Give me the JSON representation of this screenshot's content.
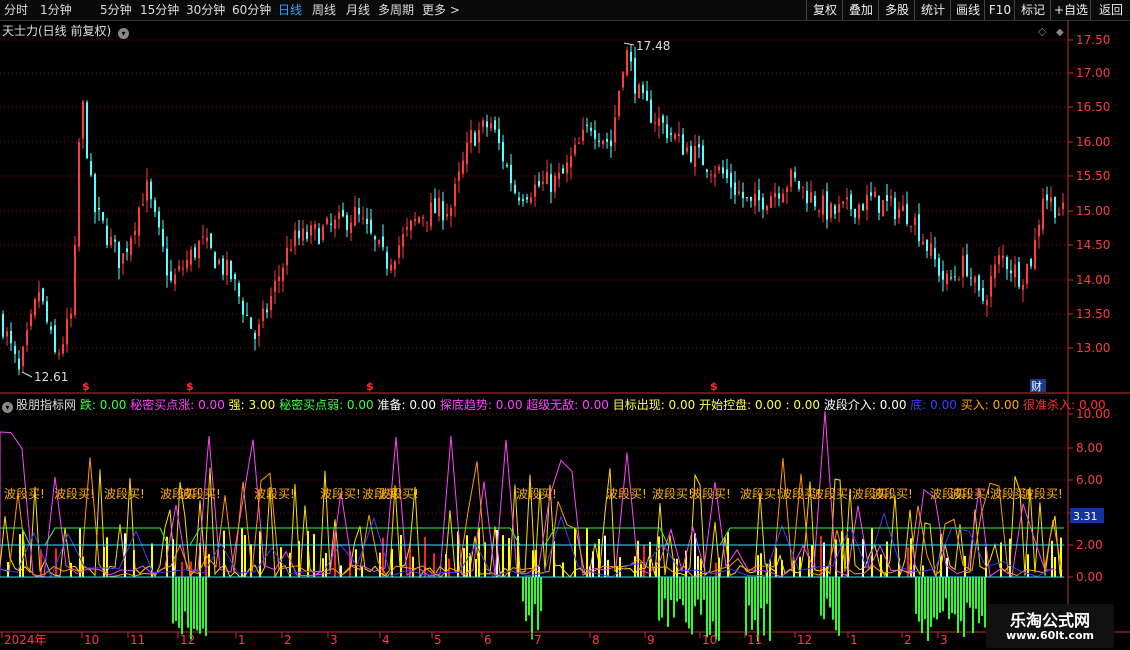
{
  "toolbar": {
    "periods": [
      "分时",
      "1分钟",
      "5分钟",
      "15分钟",
      "30分钟",
      "60分钟",
      "日线",
      "周线",
      "月线",
      "多周期",
      "更多 >"
    ],
    "active_period": "日线",
    "right_buttons": [
      "复权",
      "叠加",
      "多股",
      "统计",
      "画线",
      "F10",
      "标记",
      "+自选",
      "返回"
    ]
  },
  "main_chart": {
    "title": "天士力(日线 前复权)",
    "high_label": "17.48",
    "low_label": "12.61",
    "y_ticks": [
      "17.50",
      "17.00",
      "16.50",
      "16.00",
      "15.50",
      "15.00",
      "14.50",
      "14.00",
      "13.50",
      "13.00"
    ],
    "event_marks": [
      "$",
      "$",
      "$",
      "$"
    ],
    "finance_mark": "财"
  },
  "indicator": {
    "name": "股朋指标网",
    "items": [
      {
        "label": "跌: ",
        "value": "0.00",
        "color": "#3dff3d"
      },
      {
        "label": "秘密买点涨: ",
        "value": "0.00",
        "color": "#ff44ff"
      },
      {
        "label": "强: ",
        "value": "3.00",
        "color": "#ffff44"
      },
      {
        "label": "秘密买点弱: ",
        "value": "0.00",
        "color": "#3dff3d"
      },
      {
        "label": "准备: ",
        "value": "0.00",
        "color": "#ffffff"
      },
      {
        "label": "探底趋势: ",
        "value": "0.00",
        "color": "#ff44ff"
      },
      {
        "label": "超级无敌: ",
        "value": "0.00",
        "color": "#ff44ff"
      },
      {
        "label": "目标出现: ",
        "value": "0.00",
        "color": "#ffff44"
      },
      {
        "label": "开始控盘: ",
        "value": "0.00  : 0.00",
        "color": "#ffff44"
      },
      {
        "label": "波段介入: ",
        "value": "0.00",
        "color": "#ffffff"
      },
      {
        "label": "底: ",
        "value": "0.00",
        "color": "#3d3dff"
      },
      {
        "label": "买入: ",
        "value": "0.00",
        "color": "#ffaa00"
      },
      {
        "label": "很准杀入: ",
        "value": "0.00",
        "color": "#ff3030"
      }
    ],
    "y_ticks": [
      "10.00",
      "8.00",
      "6.00",
      "4.00",
      "2.00",
      "0.00"
    ],
    "current_value": "3.31",
    "signal_text": "波段买!"
  },
  "time_axis": [
    "2024年",
    "10",
    "11",
    "12",
    "1",
    "2",
    "3",
    "4",
    "5",
    "6",
    "7",
    "8",
    "9",
    "10",
    "11",
    "12",
    "1",
    "2",
    "3"
  ],
  "watermark": {
    "name": "乐淘公式网",
    "url": "www.60lt.com"
  },
  "colors": {
    "up": "#ff3b3b",
    "down": "#54ffff",
    "grid": "#8b0000",
    "axis": "#c03030"
  }
}
